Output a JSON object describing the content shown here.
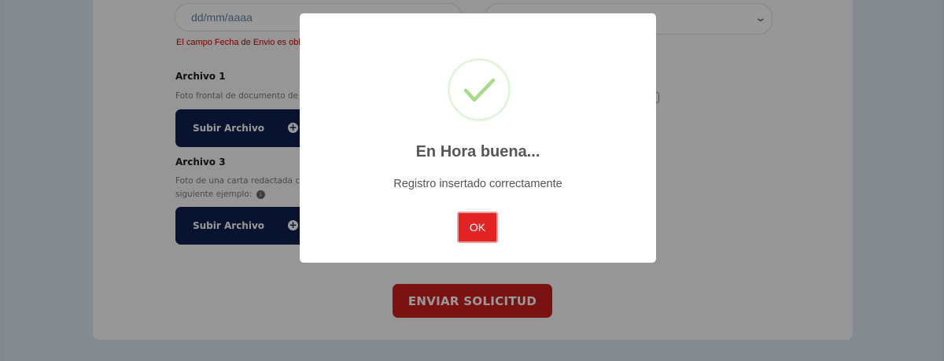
{
  "form": {
    "date_placeholder": "dd/mm/aaaa",
    "date_error": "El campo Fecha de Envio es oblig",
    "archivo1": {
      "title": "Archivo 1",
      "description": "Foto frontal de documento de",
      "upload_label": "Subir Archivo"
    },
    "archivo3": {
      "title": "Archivo 3",
      "description_line1": "Foto de una carta redactada co",
      "description_line2": "siguiente ejemplo:",
      "upload_label": "Subir Archivo"
    },
    "submit_label": "ENVIAR SOLICITUD"
  },
  "icons": {
    "upload": "plus-circle",
    "info": "info-circle",
    "select": "chevron-down",
    "success": "check"
  },
  "modal": {
    "title": "En Hora buena...",
    "message": "Registro insertado correctamente",
    "ok_label": "OK"
  },
  "colors": {
    "upload_button": "#0f1f4d",
    "submit_button": "#cc1f1f",
    "ok_button": "#e32424",
    "success_check": "#a5dc86",
    "error_text": "#c40000"
  }
}
